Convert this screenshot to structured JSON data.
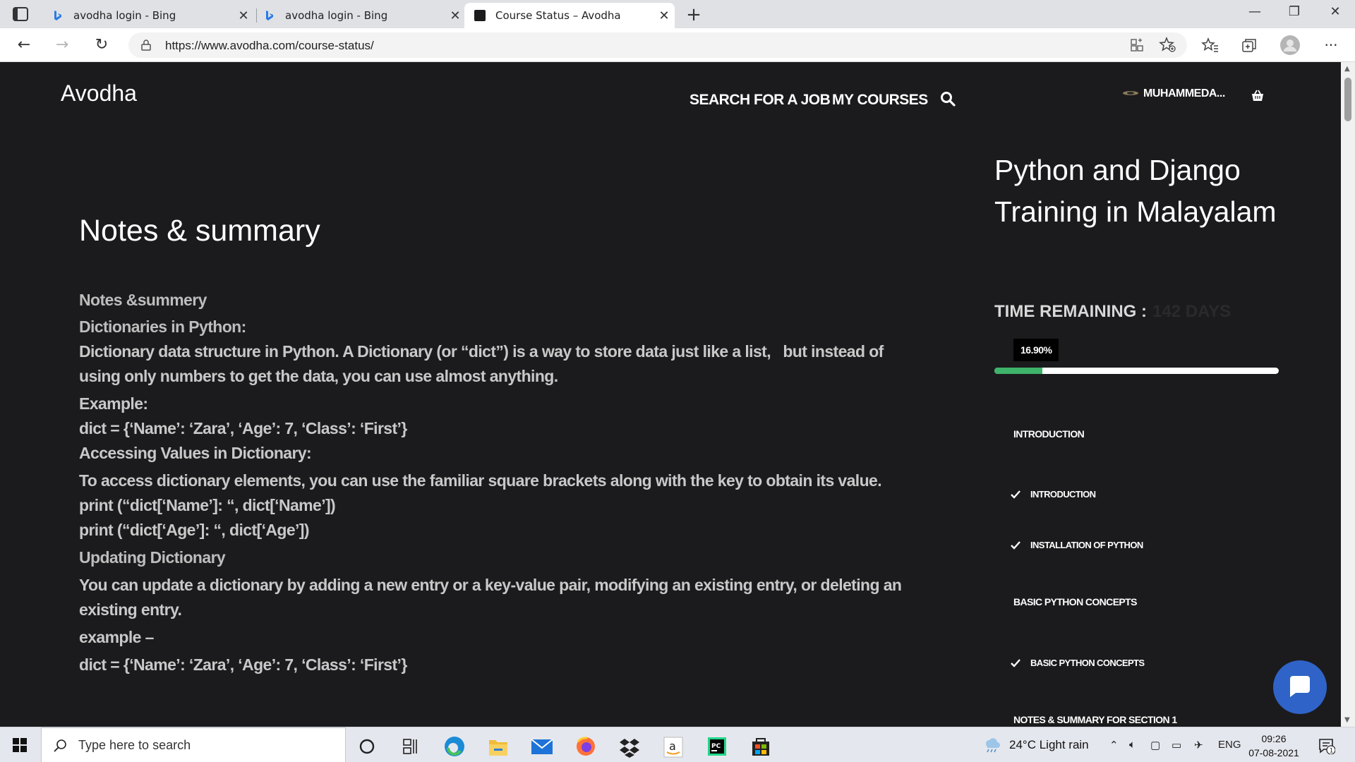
{
  "browser": {
    "tabs": [
      {
        "title": "avodha login - Bing",
        "active": false
      },
      {
        "title": "avodha login - Bing",
        "active": false
      },
      {
        "title": "Course Status – Avodha",
        "active": true
      }
    ],
    "url": "https://www.avodha.com/course-status/"
  },
  "site": {
    "logo": "Avodha",
    "nav": {
      "search_job": "SEARCH FOR A JOB",
      "my_courses": "MY COURSES"
    },
    "user_name": "MUHAMMEDA..."
  },
  "main": {
    "unit_title": "Notes & summary",
    "heading1": "Notes &summery",
    "heading2": "Dictionaries in Python:",
    "para1": "Dictionary data structure in Python. A Dictionary (or “dict”) is a way to store data just like a list,   but instead of using only numbers to get the data, you can use almost anything.",
    "example_label": "Example:",
    "code1": "dict = {‘Name’: ‘Zara’, ‘Age’: 7, ‘Class’: ‘First’}",
    "accessing_heading": "Accessing Values in Dictionary:",
    "para2": "To access dictionary elements, you can use the familiar square brackets along with the key to obtain its value.",
    "code2": "print (“dict[‘Name’]: “, dict[‘Name’])",
    "code3": "print (“dict[‘Age’]: “, dict[‘Age’])",
    "updating_heading": "Updating Dictionary",
    "para3": "You can update a dictionary by adding a new entry or a key-value pair, modifying an existing entry, or deleting an existing entry.",
    "example2_label": "example –",
    "code4": "dict = {‘Name’: ‘Zara’, ‘Age’: 7, ‘Class’: ‘First’}"
  },
  "sidebar": {
    "course_title": "Python and Django Training in Malayalam",
    "time_remaining_label": "TIME REMAINING :",
    "time_remaining_value": "142 DAYS",
    "progress_label": "16.90%",
    "progress_fraction": 0.169,
    "sections": [
      {
        "label": "INTRODUCTION"
      },
      {
        "label": "INTRODUCTION",
        "completed": true
      },
      {
        "label": "INSTALLATION OF PYTHON",
        "completed": true
      },
      {
        "label": "BASIC PYTHON CONCEPTS"
      },
      {
        "label": "BASIC PYTHON CONCEPTS",
        "completed": true
      },
      {
        "label": "NOTES & SUMMARY FOR SECTION 1"
      }
    ]
  },
  "taskbar": {
    "search_placeholder": "Type here to search",
    "weather": "24°C  Light rain",
    "language": "ENG",
    "time": "09:26",
    "date": "07-08-2021",
    "notification_count": "1"
  },
  "colors": {
    "progress": "#3eb36a",
    "chat_button": "#2f63c8",
    "page_bg": "#1b1b1d"
  }
}
